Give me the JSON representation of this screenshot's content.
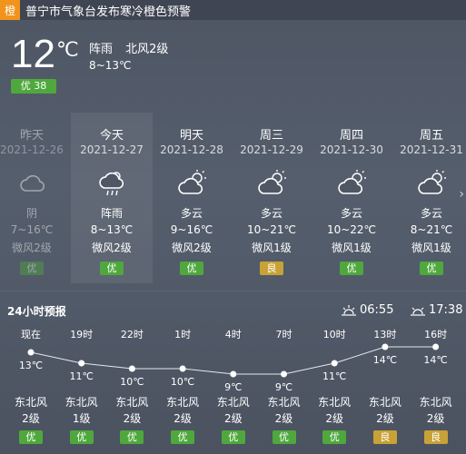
{
  "warning": {
    "badge": "橙",
    "text": "普宁市气象台发布寒冷橙色预警"
  },
  "current": {
    "temperature": "12",
    "unit": "℃",
    "condition": "阵雨",
    "wind": "北风2级",
    "range": "8~13℃",
    "aqi": "优 38"
  },
  "daily": [
    {
      "name": "昨天",
      "date": "2021-12-26",
      "icon": "cloudy-icon",
      "condition": "阴",
      "range": "7~16℃",
      "wind": "微风2级",
      "aqi": "优",
      "aqi_level": "good",
      "past": true
    },
    {
      "name": "今天",
      "date": "2021-12-27",
      "icon": "shower-icon",
      "condition": "阵雨",
      "range": "8~13℃",
      "wind": "微风2级",
      "aqi": "优",
      "aqi_level": "good",
      "today": true
    },
    {
      "name": "明天",
      "date": "2021-12-28",
      "icon": "partly-cloudy-icon",
      "condition": "多云",
      "range": "9~16℃",
      "wind": "微风2级",
      "aqi": "优",
      "aqi_level": "good"
    },
    {
      "name": "周三",
      "date": "2021-12-29",
      "icon": "partly-cloudy-icon",
      "condition": "多云",
      "range": "10~21℃",
      "wind": "微风1级",
      "aqi": "良",
      "aqi_level": "moderate"
    },
    {
      "name": "周四",
      "date": "2021-12-30",
      "icon": "partly-cloudy-icon",
      "condition": "多云",
      "range": "10~22℃",
      "wind": "微风1级",
      "aqi": "优",
      "aqi_level": "good"
    },
    {
      "name": "周五",
      "date": "2021-12-31",
      "icon": "partly-cloudy-icon",
      "condition": "多云",
      "range": "8~21℃",
      "wind": "微风1级",
      "aqi": "优",
      "aqi_level": "good"
    }
  ],
  "hourly": {
    "title": "24小时预报",
    "sunrise": "06:55",
    "sunset": "17:38",
    "hours": [
      {
        "time": "现在",
        "temp": 13,
        "temp_label": "13℃",
        "wind_dir": "东北风",
        "wind_level": "2级",
        "aqi": "优",
        "aqi_level": "good"
      },
      {
        "time": "19时",
        "temp": 11,
        "temp_label": "11℃",
        "wind_dir": "东北风",
        "wind_level": "1级",
        "aqi": "优",
        "aqi_level": "good"
      },
      {
        "time": "22时",
        "temp": 10,
        "temp_label": "10℃",
        "wind_dir": "东北风",
        "wind_level": "2级",
        "aqi": "优",
        "aqi_level": "good"
      },
      {
        "time": "1时",
        "temp": 10,
        "temp_label": "10℃",
        "wind_dir": "东北风",
        "wind_level": "2级",
        "aqi": "优",
        "aqi_level": "good"
      },
      {
        "time": "4时",
        "temp": 9,
        "temp_label": "9℃",
        "wind_dir": "东北风",
        "wind_level": "2级",
        "aqi": "优",
        "aqi_level": "good"
      },
      {
        "time": "7时",
        "temp": 9,
        "temp_label": "9℃",
        "wind_dir": "东北风",
        "wind_level": "2级",
        "aqi": "优",
        "aqi_level": "good"
      },
      {
        "time": "10时",
        "temp": 11,
        "temp_label": "11℃",
        "wind_dir": "东北风",
        "wind_level": "2级",
        "aqi": "优",
        "aqi_level": "good"
      },
      {
        "time": "13时",
        "temp": 14,
        "temp_label": "14℃",
        "wind_dir": "东北风",
        "wind_level": "2级",
        "aqi": "良",
        "aqi_level": "moderate"
      },
      {
        "time": "16时",
        "temp": 14,
        "temp_label": "14℃",
        "wind_dir": "东北风",
        "wind_level": "2级",
        "aqi": "良",
        "aqi_level": "moderate"
      }
    ]
  },
  "colors": {
    "aqi_good": "#4fa83d",
    "aqi_moderate": "#c8a236",
    "warning_orange": "#f0941c"
  }
}
